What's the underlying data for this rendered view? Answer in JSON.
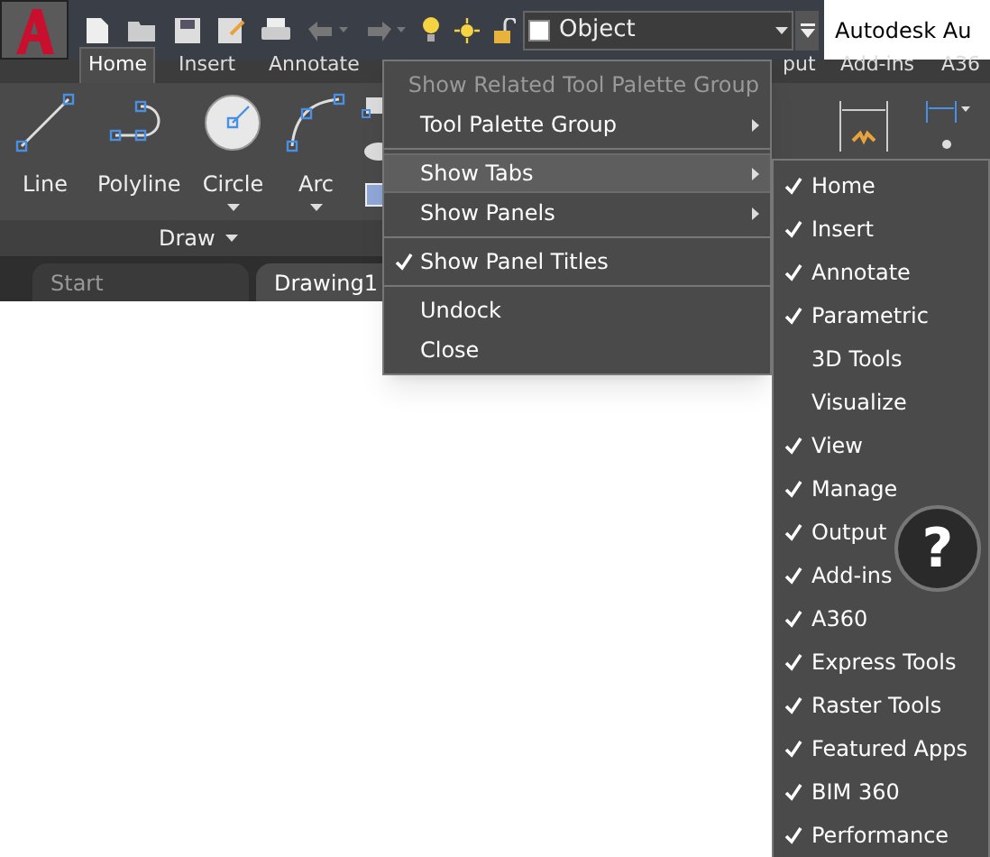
{
  "title_bar": {
    "layer": "Object",
    "title": "Autodesk Au"
  },
  "ribbon_tabs": [
    {
      "label": "Home",
      "selected": true
    },
    {
      "label": "Insert",
      "selected": false
    },
    {
      "label": "Annotate",
      "selected": false
    },
    {
      "label": "put",
      "selected": false
    },
    {
      "label": "Add-ins",
      "selected": false
    },
    {
      "label": "A36",
      "selected": false
    }
  ],
  "draw_tools": [
    {
      "label": "Line",
      "kind": "line",
      "dropdown": false
    },
    {
      "label": "Polyline",
      "kind": "polyline",
      "dropdown": false
    },
    {
      "label": "Circle",
      "kind": "circle",
      "dropdown": true
    },
    {
      "label": "Arc",
      "kind": "arc",
      "dropdown": true
    }
  ],
  "panel_title": "Draw",
  "file_tabs": [
    {
      "label": "Start",
      "selected": false
    },
    {
      "label": "Drawing1",
      "selected": true
    }
  ],
  "menu": {
    "groups": [
      [
        {
          "label": "Show Related Tool Palette Group",
          "disabled": true,
          "checked": false,
          "submenu": false,
          "selected": false
        },
        {
          "label": "Tool Palette Group",
          "disabled": false,
          "checked": false,
          "submenu": true,
          "selected": false
        }
      ],
      [
        {
          "label": "Show Tabs",
          "disabled": false,
          "checked": false,
          "submenu": true,
          "selected": true
        },
        {
          "label": "Show Panels",
          "disabled": false,
          "checked": false,
          "submenu": true,
          "selected": false
        }
      ],
      [
        {
          "label": "Show Panel Titles",
          "disabled": false,
          "checked": true,
          "submenu": false,
          "selected": false
        }
      ],
      [
        {
          "label": "Undock",
          "disabled": false,
          "checked": false,
          "submenu": false,
          "selected": false
        },
        {
          "label": "Close",
          "disabled": false,
          "checked": false,
          "submenu": false,
          "selected": false
        }
      ]
    ]
  },
  "submenu": [
    {
      "label": "Home",
      "checked": true
    },
    {
      "label": "Insert",
      "checked": true
    },
    {
      "label": "Annotate",
      "checked": true
    },
    {
      "label": "Parametric",
      "checked": true
    },
    {
      "label": "3D Tools",
      "checked": false
    },
    {
      "label": "Visualize",
      "checked": false
    },
    {
      "label": "View",
      "checked": true
    },
    {
      "label": "Manage",
      "checked": true
    },
    {
      "label": "Output",
      "checked": true
    },
    {
      "label": "Add-ins",
      "checked": true
    },
    {
      "label": "A360",
      "checked": true
    },
    {
      "label": "Express Tools",
      "checked": true
    },
    {
      "label": "Raster Tools",
      "checked": true
    },
    {
      "label": "Featured Apps",
      "checked": true
    },
    {
      "label": "BIM 360",
      "checked": true
    },
    {
      "label": "Performance",
      "checked": true
    }
  ],
  "help_button": {
    "label": "?"
  }
}
